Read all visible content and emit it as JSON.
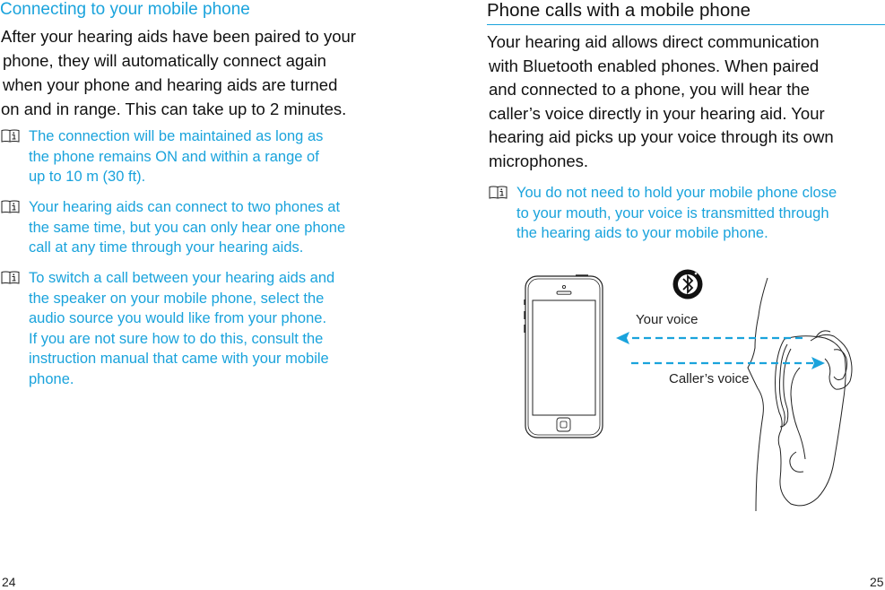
{
  "left_page": {
    "heading": "Connecting to your mobile phone",
    "body_lines": [
      "After your hearing aids have been paired to your",
      "phone, they will automatically connect again",
      "when your phone and hearing aids are turned",
      "on and in range. This can take up to 2 minutes."
    ],
    "notes": [
      {
        "icon": "info-book-icon",
        "lines": [
          "The connection will be maintained as long as",
          "the phone remains ON and within a range of",
          "up to 10 m (30 ft)."
        ]
      },
      {
        "icon": "info-book-icon",
        "lines": [
          "Your hearing aids can connect to two phones at",
          "the same time, but you can only hear one phone",
          "call at any time through your hearing aids."
        ]
      },
      {
        "icon": "info-book-icon",
        "lines": [
          "To switch a call between your hearing aids and",
          "the speaker on your mobile phone, select the",
          "audio source you would like from your phone.",
          "If you are not sure how to do this, consult the",
          "instruction manual that came with your mobile",
          "phone."
        ]
      }
    ],
    "page_number": "24"
  },
  "right_page": {
    "heading": "Phone calls with a mobile phone",
    "body_lines": [
      "Your hearing aid allows direct communication",
      "with Bluetooth enabled phones. When paired",
      "and connected to a phone, you will hear the",
      "caller’s voice directly in your hearing aid. Your",
      "hearing aid picks up your voice through its own",
      "microphones."
    ],
    "note": {
      "icon": "info-book-icon",
      "lines": [
        "You do not need to hold your mobile phone close",
        "to your mouth, your voice is transmitted through",
        "the hearing aids to your mobile phone."
      ]
    },
    "diagram": {
      "label_your_voice": "Your voice",
      "label_callers_voice": "Caller’s voice",
      "icons": [
        "smartphone-icon",
        "bluetooth-icon",
        "ear-with-hearing-aid-icon"
      ]
    },
    "page_number": "25"
  },
  "colors": {
    "accent": "#1aa3dc",
    "text": "#111111"
  }
}
